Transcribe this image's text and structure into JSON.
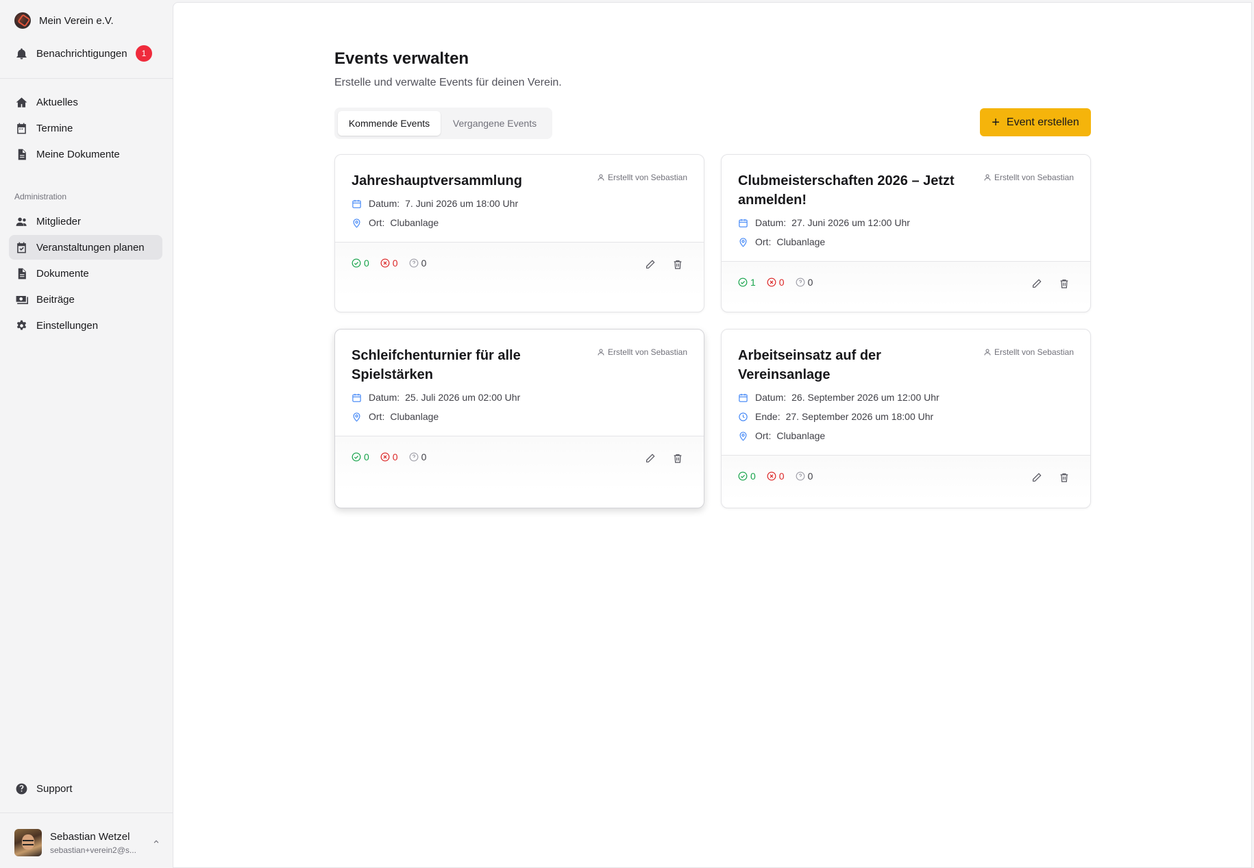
{
  "sidebar": {
    "org_name": "Mein Verein e.V.",
    "notifications_label": "Benachrichtigungen",
    "notifications_count": "1",
    "nav": [
      {
        "label": "Aktuelles",
        "icon": "home-icon"
      },
      {
        "label": "Termine",
        "icon": "calendar-icon"
      },
      {
        "label": "Meine Dokumente",
        "icon": "document-icon"
      }
    ],
    "admin_section": "Administration",
    "admin_nav": [
      {
        "label": "Mitglieder",
        "icon": "users-icon"
      },
      {
        "label": "Veranstaltungen planen",
        "icon": "calendar-plan-icon",
        "active": true
      },
      {
        "label": "Dokumente",
        "icon": "document-icon"
      },
      {
        "label": "Beiträge",
        "icon": "money-icon"
      },
      {
        "label": "Einstellungen",
        "icon": "gear-icon"
      }
    ],
    "support_label": "Support",
    "user": {
      "name": "Sebastian Wetzel",
      "email": "sebastian+verein2@s..."
    }
  },
  "main": {
    "title": "Events verwalten",
    "subtitle": "Erstelle und verwalte Events für deinen Verein.",
    "tabs": [
      {
        "label": "Kommende Events",
        "active": true
      },
      {
        "label": "Vergangene Events",
        "active": false
      }
    ],
    "create_button": "Event erstellen"
  },
  "events": [
    {
      "title": "Jahreshauptversammlung",
      "creator": "Erstellt von Sebastian",
      "date_label": "Datum:",
      "date": "7. Juni 2026 um 18:00 Uhr",
      "place_label": "Ort:",
      "place": "Clubanlage",
      "yes": "0",
      "no": "0",
      "maybe": "0"
    },
    {
      "title": "Clubmeisterschaften 2026 – Jetzt anmelden!",
      "creator": "Erstellt von Sebastian",
      "date_label": "Datum:",
      "date": "27. Juni 2026 um 12:00 Uhr",
      "place_label": "Ort:",
      "place": "Clubanlage",
      "yes": "1",
      "no": "0",
      "maybe": "0"
    },
    {
      "title": "Schleifchenturnier für alle Spielstärken",
      "creator": "Erstellt von Sebastian",
      "date_label": "Datum:",
      "date": "25. Juli 2026 um 02:00 Uhr",
      "place_label": "Ort:",
      "place": "Clubanlage",
      "yes": "0",
      "no": "0",
      "maybe": "0"
    },
    {
      "title": "Arbeitseinsatz auf der Vereinsanlage",
      "creator": "Erstellt von Sebastian",
      "date_label": "Datum:",
      "date": "26. September 2026 um 12:00 Uhr",
      "end_label": "Ende:",
      "end": "27. September 2026 um 18:00 Uhr",
      "place_label": "Ort:",
      "place": "Clubanlage",
      "yes": "0",
      "no": "0",
      "maybe": "0"
    }
  ]
}
